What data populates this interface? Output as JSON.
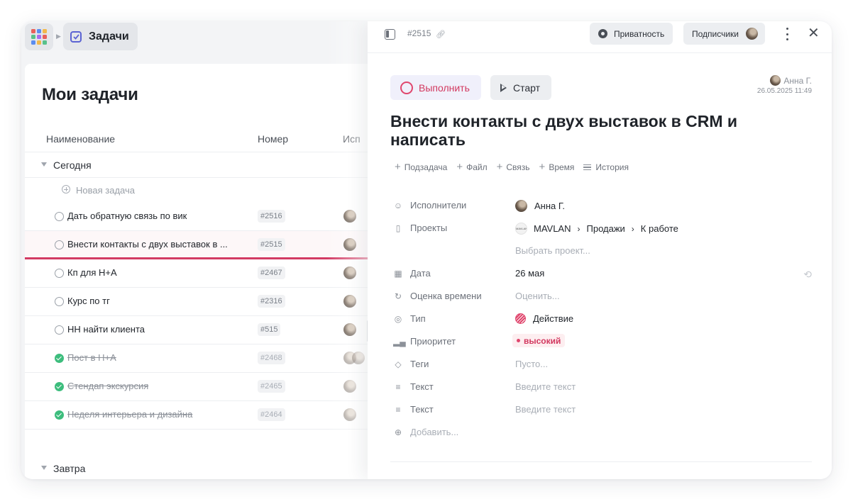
{
  "breadcrumb": {
    "tasks_label": "Задачи"
  },
  "list": {
    "title": "Мои задачи",
    "columns": {
      "name": "Наименование",
      "number": "Номер",
      "assignee": "Исп"
    },
    "groups": {
      "today": "Сегодня",
      "tomorrow": "Завтра"
    },
    "new_task": "Новая задача",
    "rows": [
      {
        "name": "Дать обратную связь по вик",
        "number": "#2516",
        "done": false
      },
      {
        "name": "Внести контакты с двух выставок в ...",
        "number": "#2515",
        "done": false
      },
      {
        "name": "Кп для Н+А",
        "number": "#2467",
        "done": false
      },
      {
        "name": "Курс по тг",
        "number": "#2316",
        "done": false
      },
      {
        "name": "НН найти клиента",
        "number": "#515",
        "done": false
      },
      {
        "name": "Пост в Н+А",
        "number": "#2468",
        "done": true
      },
      {
        "name": "Стендап экскурсия",
        "number": "#2465",
        "done": true
      },
      {
        "name": "Неделя интерьера и дизайна",
        "number": "#2464",
        "done": true
      }
    ]
  },
  "panel": {
    "task_number": "#2515",
    "privacy_label": "Приватность",
    "subscribers_label": "Подписчики",
    "complete_label": "Выполнить",
    "start_label": "Старт",
    "author": {
      "name": "Анна Г.",
      "date": "26.05.2025 11:49"
    },
    "title": "Внести контакты с двух выставок в CRM и написать",
    "actions": {
      "subtask": "Подзадача",
      "file": "Файл",
      "link": "Связь",
      "time": "Время",
      "history": "История"
    },
    "fields": {
      "assignees": {
        "label": "Исполнители",
        "value": "Анна Г."
      },
      "projects": {
        "label": "Проекты",
        "path": [
          "MAVLAN",
          "Продажи",
          "К работе"
        ],
        "logo_text": "MAVLAN",
        "choose_placeholder": "Выбрать проект..."
      },
      "date": {
        "label": "Дата",
        "value": "26 мая"
      },
      "estimate": {
        "label": "Оценка времени",
        "placeholder": "Оценить..."
      },
      "type": {
        "label": "Тип",
        "value": "Действие"
      },
      "priority": {
        "label": "Приоритет",
        "value": "высокий"
      },
      "tags": {
        "label": "Теги",
        "placeholder": "Пусто..."
      },
      "text1": {
        "label": "Текст",
        "placeholder": "Введите текст"
      },
      "text2": {
        "label": "Текст",
        "placeholder": "Введите текст"
      },
      "add": {
        "label": "Добавить..."
      }
    }
  },
  "colors": {
    "accent": "#d2385f",
    "brand": "#5b63d3",
    "done": "#3dbd7d"
  },
  "icons": {
    "apps": "apps-grid-icon",
    "tasks": "checkbox-icon",
    "sidebar": "sidebar-toggle-icon",
    "link": "link-icon",
    "privacy": "eye-icon",
    "more": "more-vertical-icon",
    "close": "close-icon"
  }
}
